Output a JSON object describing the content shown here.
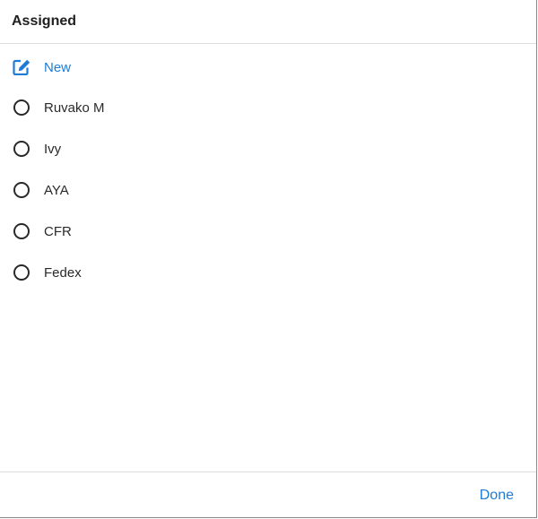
{
  "dialog": {
    "title": "Assigned",
    "new_label": "New",
    "options": [
      {
        "label": "Ruvako M",
        "selected": false
      },
      {
        "label": "Ivy",
        "selected": false
      },
      {
        "label": "AYA",
        "selected": false
      },
      {
        "label": "CFR",
        "selected": false
      },
      {
        "label": "Fedex",
        "selected": false
      }
    ],
    "done_label": "Done"
  },
  "colors": {
    "accent": "#1e7bd6",
    "text": "#2a2a2a",
    "divider": "#dcdcdc"
  },
  "icons": {
    "new": "edit-icon",
    "option": "radio-unchecked-icon"
  }
}
